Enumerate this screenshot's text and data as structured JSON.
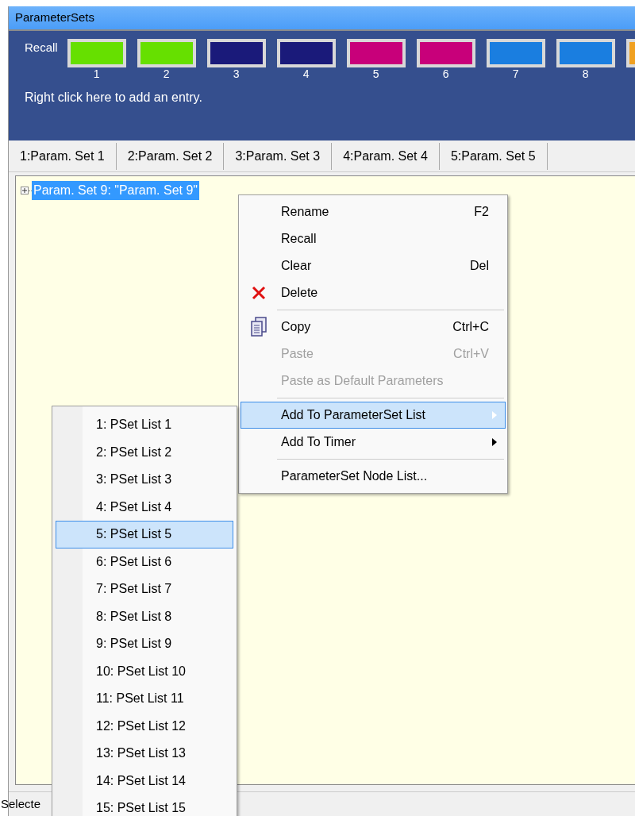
{
  "window": {
    "title": "ParameterSets"
  },
  "recall": {
    "label": "Recall",
    "hint": "Right click here to add an entry.",
    "swatches": [
      {
        "label": "1",
        "color": "#66e000"
      },
      {
        "label": "2",
        "color": "#66e000"
      },
      {
        "label": "3",
        "color": "#1a1a7a"
      },
      {
        "label": "4",
        "color": "#1a1a7a"
      },
      {
        "label": "5",
        "color": "#c8007a"
      },
      {
        "label": "6",
        "color": "#c8007a"
      },
      {
        "label": "7",
        "color": "#1a7ee0"
      },
      {
        "label": "8",
        "color": "#1a7ee0"
      },
      {
        "color": "#f0a020"
      }
    ]
  },
  "tabs": [
    {
      "label": "1:Param. Set 1",
      "selected": false
    },
    {
      "label": "2:Param. Set 2",
      "selected": false
    },
    {
      "label": "3:Param. Set 3",
      "selected": false
    },
    {
      "label": "4:Param. Set 4",
      "selected": false
    },
    {
      "label": "5:Param. Set 5",
      "selected": false
    }
  ],
  "tree": {
    "items": [
      {
        "label": "Param. Set 9: \"Param. Set 9\"",
        "selected": true,
        "expanded": false
      }
    ]
  },
  "context_menu": {
    "items": [
      {
        "kind": "item",
        "label": "Rename",
        "shortcut": "F2",
        "disabled": false,
        "selected": false
      },
      {
        "kind": "item",
        "label": "Recall",
        "disabled": false,
        "selected": false
      },
      {
        "kind": "item",
        "label": "Clear",
        "shortcut": "Del",
        "disabled": false,
        "selected": false
      },
      {
        "kind": "delete",
        "label": "Delete",
        "disabled": false,
        "selected": false
      },
      {
        "kind": "separator"
      },
      {
        "kind": "copy",
        "label": "Copy",
        "shortcut": "Ctrl+C",
        "disabled": false,
        "selected": false
      },
      {
        "kind": "item",
        "label": "Paste",
        "shortcut": "Ctrl+V",
        "disabled": true,
        "selected": false
      },
      {
        "kind": "item",
        "label": "Paste as Default Parameters",
        "disabled": true,
        "selected": false
      },
      {
        "kind": "separator"
      },
      {
        "kind": "item",
        "label": "Add To ParameterSet List",
        "submenu": true,
        "disabled": false,
        "selected": true
      },
      {
        "kind": "item",
        "label": "Add To Timer",
        "submenu": true,
        "disabled": false,
        "selected": false
      },
      {
        "kind": "separator"
      },
      {
        "kind": "item",
        "label": "ParameterSet Node List...",
        "disabled": false,
        "selected": false
      }
    ]
  },
  "submenu": {
    "items": [
      {
        "label": "1: PSet List 1",
        "selected": false
      },
      {
        "label": "2: PSet List 2",
        "selected": false
      },
      {
        "label": "3: PSet List 3",
        "selected": false
      },
      {
        "label": "4: PSet List 4",
        "selected": false
      },
      {
        "label": "5: PSet List 5",
        "selected": true
      },
      {
        "label": "6: PSet List 6",
        "selected": false
      },
      {
        "label": "7: PSet List 7",
        "selected": false
      },
      {
        "label": "8: PSet List 8",
        "selected": false
      },
      {
        "label": "9: PSet List 9",
        "selected": false
      },
      {
        "label": "10: PSet List 10",
        "selected": false
      },
      {
        "label": "11: PSet List 11",
        "selected": false
      },
      {
        "label": "12: PSet List 12",
        "selected": false
      },
      {
        "label": "13: PSet List 13",
        "selected": false
      },
      {
        "label": "14: PSet List 14",
        "selected": false
      },
      {
        "label": "15: PSet List 15",
        "selected": false
      }
    ]
  },
  "status_bar": {
    "text": "Selecte"
  }
}
